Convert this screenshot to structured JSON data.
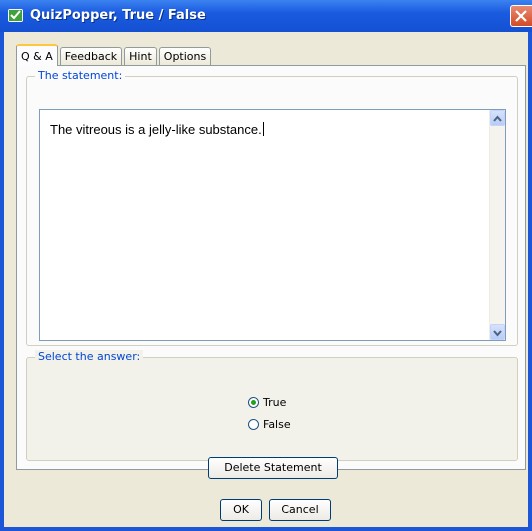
{
  "window": {
    "title": "QuizPopper, True / False",
    "colors": {
      "titlebar": "#1a5be0",
      "close": "#d24a25",
      "face": "#ece9d8",
      "accent": "#0046d5"
    }
  },
  "tabs": [
    {
      "label": "Q & A",
      "active": true
    },
    {
      "label": "Feedback",
      "active": false
    },
    {
      "label": "Hint",
      "active": false
    },
    {
      "label": "Options",
      "active": false
    }
  ],
  "statement": {
    "legend": "The statement:",
    "text": "The vitreous is a jelly-like substance."
  },
  "answer": {
    "legend": "Select the answer:",
    "options": [
      {
        "label": "True",
        "checked": true
      },
      {
        "label": "False",
        "checked": false
      }
    ]
  },
  "buttons": {
    "delete": "Delete Statement",
    "ok": "OK",
    "cancel": "Cancel"
  },
  "icons": [
    "app-icon",
    "close-icon",
    "scroll-up-icon",
    "scroll-down-icon"
  ]
}
